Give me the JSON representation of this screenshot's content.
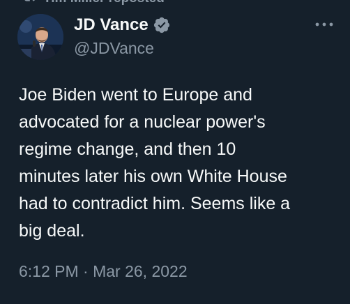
{
  "repost": {
    "text": "Tim Miller reposted",
    "icon": "repost-icon"
  },
  "author": {
    "name": "JD Vance",
    "handle": "@JDVance",
    "verified_icon": "verified-badge-icon",
    "avatar": "avatar-photo"
  },
  "more": {
    "icon": "more-options-icon",
    "label": "..."
  },
  "tweet": {
    "lines": [
      "Joe Biden went to Europe and",
      "advocated for a nuclear power's",
      "regime change, and then 10",
      "minutes later his own White House",
      "had to contradict him. Seems like a",
      "big deal."
    ]
  },
  "timestamp": "6:12 PM · Mar 26, 2022",
  "colors": {
    "background": "#15202b",
    "primary_text": "#f7f9f9",
    "secondary_text": "#8b98a5",
    "verified_badge": "#8b98a5"
  }
}
